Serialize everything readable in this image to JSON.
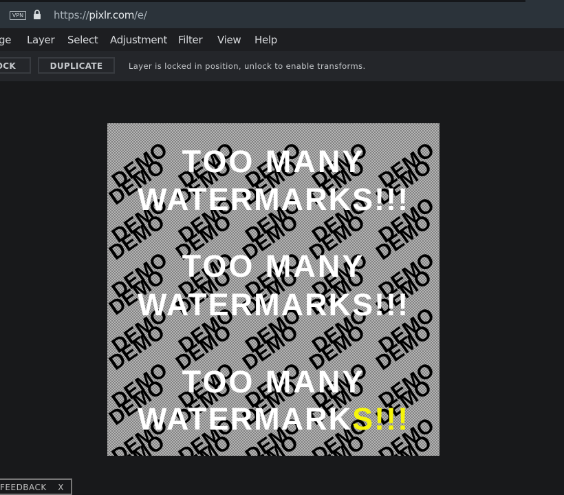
{
  "browser": {
    "vpn_label": "VPN",
    "url_scheme": "https://",
    "url_host": "pixlr.com",
    "url_path": "/e/"
  },
  "menu": {
    "items": [
      {
        "label": "ge"
      },
      {
        "label": "Layer"
      },
      {
        "label": "Select"
      },
      {
        "label": "Adjustment"
      },
      {
        "label": "Filter"
      },
      {
        "label": "View"
      },
      {
        "label": "Help"
      }
    ]
  },
  "toolbar": {
    "unlock_label": "OCK",
    "duplicate_label": "DUPLICATE",
    "message": "Layer is locked in position, unlock to enable transforms."
  },
  "canvas": {
    "watermark_word": "DEMO",
    "headline_line1": "TOO MANY",
    "headline_line2_white": "WATERMARK",
    "headline_line2_tail": "S!!!",
    "highlight_color": "#f5f50a"
  },
  "feedback": {
    "label": "FEEDBACK",
    "close": "X"
  }
}
